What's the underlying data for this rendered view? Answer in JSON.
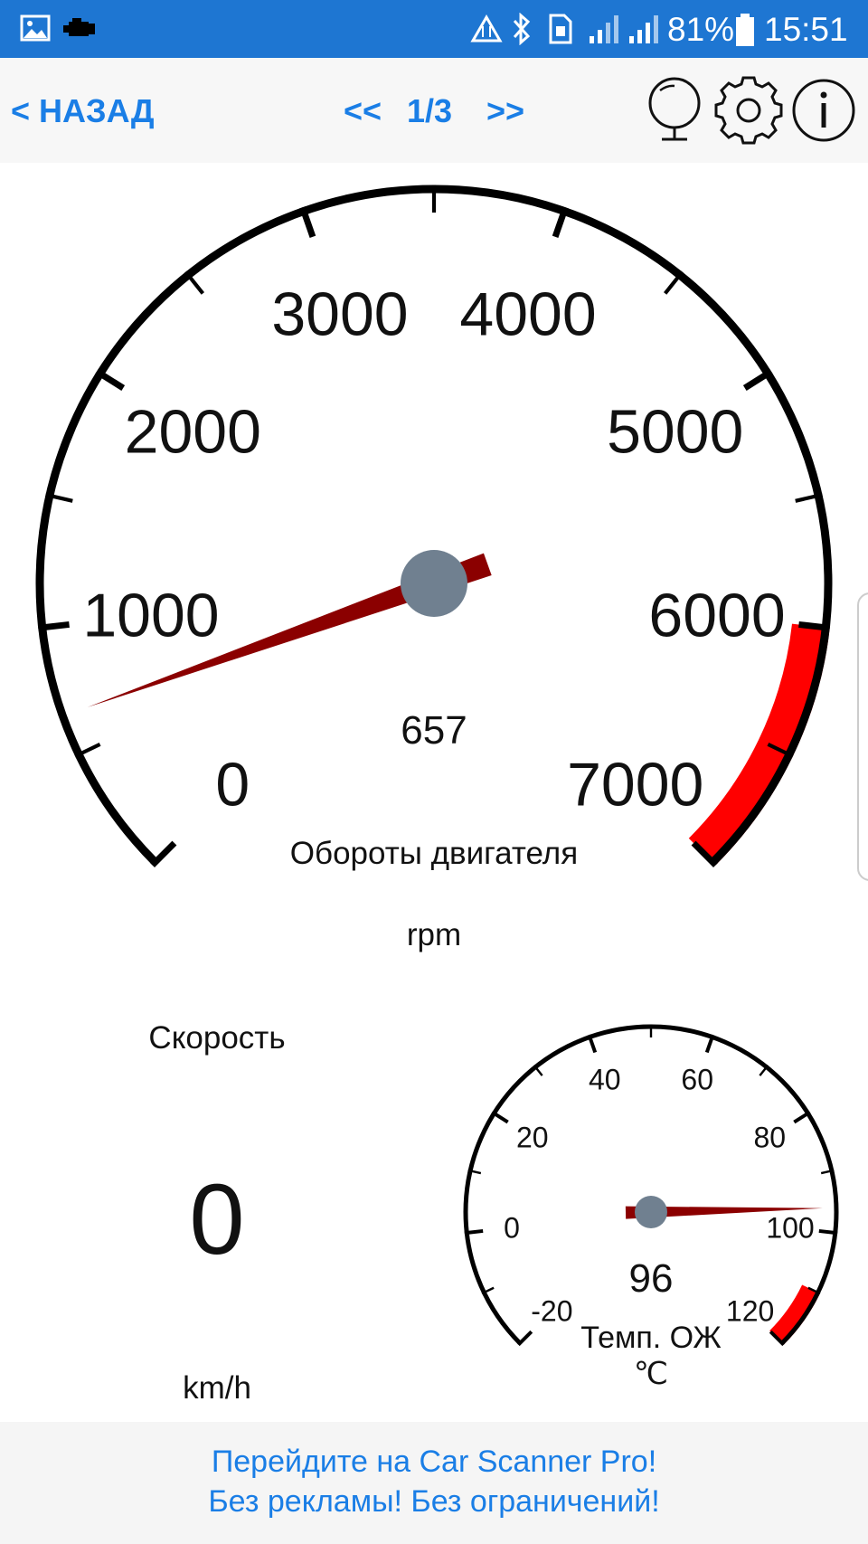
{
  "status_bar": {
    "battery": "81%",
    "time": "15:51",
    "icons": [
      "image-icon",
      "check-engine-icon",
      "data-sync-icon",
      "bluetooth-icon",
      "sim-icon",
      "signal-icon",
      "signal-icon",
      "battery-icon"
    ]
  },
  "toolbar": {
    "back_label": "< НАЗАД",
    "prev_label": "<<",
    "page": "1/3",
    "next_label": ">>",
    "icons": [
      "mirror-icon",
      "gear-icon",
      "info-icon"
    ]
  },
  "rpm_gauge": {
    "title": "Обороты двигателя",
    "unit": "rpm",
    "value": 657,
    "value_text": "657",
    "min": 0,
    "max": 7000,
    "red_from": 6000,
    "ticks": [
      "0",
      "1000",
      "2000",
      "3000",
      "4000",
      "5000",
      "6000",
      "7000"
    ],
    "colors": {
      "needle": "#8b0000",
      "hub": "#708090",
      "redzone": "#ff0000"
    }
  },
  "temp_gauge": {
    "title": "Темп. ОЖ",
    "unit": "℃",
    "value": 96,
    "value_text": "96",
    "min": -20,
    "max": 120,
    "red_from": 110,
    "ticks": [
      "-20",
      "0",
      "20",
      "40",
      "60",
      "80",
      "100",
      "120"
    ],
    "colors": {
      "needle": "#8b0000",
      "hub": "#708090",
      "redzone": "#ff0000"
    }
  },
  "speed": {
    "label": "Скорость",
    "value": "0",
    "unit": "km/h"
  },
  "promo": {
    "line1": "Перейдите на Car Scanner Pro!",
    "line2": "Без рекламы! Без ограничений!"
  }
}
